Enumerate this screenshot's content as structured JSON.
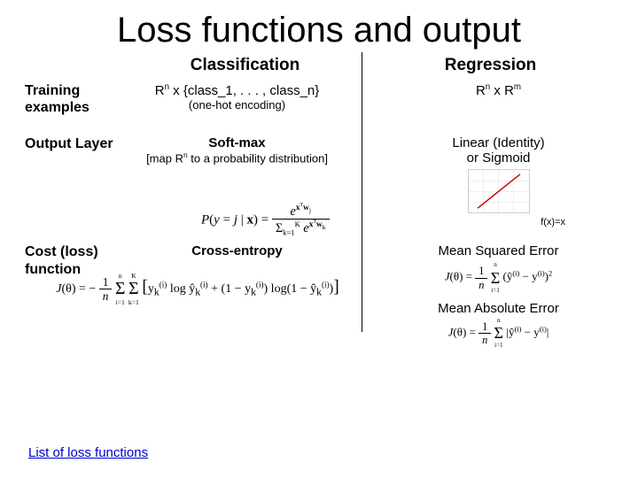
{
  "title": "Loss functions and output",
  "columns": {
    "classification": "Classification",
    "regression": "Regression"
  },
  "rows": {
    "training": {
      "label": "Training examples",
      "classification_line1": "Rⁿ x {class_1, . . . , class_n}",
      "classification_line2": "(one-hot encoding)",
      "regression": "Rⁿ x Rᵐ"
    },
    "output": {
      "label": "Output Layer",
      "classification_heading": "Soft-max",
      "classification_sub": "[map Rⁿ to a probability distribution]",
      "softmax_formula": "P(y = j | x) = eˣᵀwⱼ / Σₖ₌₁ᴷ eˣᵀwₖ",
      "regression_line1": "Linear (Identity)",
      "regression_line2": "or Sigmoid",
      "identity_caption": "f(x)=x"
    },
    "cost": {
      "label": "Cost (loss) function",
      "classification": "Cross-entropy",
      "ce_label": "J(θ) = −(1/n) Σᵢ₌₁ⁿ Σₖ₌₁ᴷ yₖ⁽ⁱ⁾ log ŷₖ⁽ⁱ⁾ + (1 − yₖ⁽ⁱ⁾) log(1 − ŷₖ⁽ⁱ⁾)",
      "regression_mse": "Mean Squared Error",
      "mse_formula": "J(θ) = (1/n) Σᵢ₌₁ⁿ (ŷ⁽ⁱ⁾ − y⁽ⁱ⁾)²",
      "regression_mae": "Mean Absolute Error",
      "mae_formula": "J(θ) = (1/n) Σᵢ₌₁ⁿ |ŷ⁽ⁱ⁾ − y⁽ⁱ⁾|"
    }
  },
  "link": "List of loss functions"
}
